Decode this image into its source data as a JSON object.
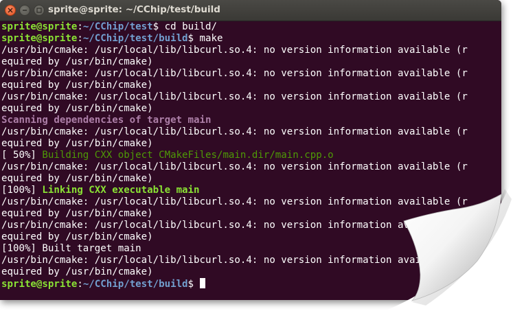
{
  "window": {
    "title": "sprite@sprite: ~/CChip/test/build"
  },
  "terminal": {
    "lines": [
      {
        "type": "prompt",
        "user": "sprite@sprite",
        "sep": ":",
        "path": "~/CChip/test",
        "end": "$ ",
        "cmd": "cd build/"
      },
      {
        "type": "prompt",
        "user": "sprite@sprite",
        "sep": ":",
        "path": "~/CChip/test/build",
        "end": "$ ",
        "cmd": "make"
      },
      {
        "type": "plain",
        "text": "/usr/bin/cmake: /usr/local/lib/libcurl.so.4: no version information available (r"
      },
      {
        "type": "plain",
        "text": "equired by /usr/bin/cmake)"
      },
      {
        "type": "plain",
        "text": "/usr/bin/cmake: /usr/local/lib/libcurl.so.4: no version information available (r"
      },
      {
        "type": "plain",
        "text": "equired by /usr/bin/cmake)"
      },
      {
        "type": "plain",
        "text": "/usr/bin/cmake: /usr/local/lib/libcurl.so.4: no version information available (r"
      },
      {
        "type": "plain",
        "text": "equired by /usr/bin/cmake)"
      },
      {
        "type": "magenta",
        "text": "Scanning dependencies of target main"
      },
      {
        "type": "plain",
        "text": "/usr/bin/cmake: /usr/local/lib/libcurl.so.4: no version information available (r"
      },
      {
        "type": "plain",
        "text": "equired by /usr/bin/cmake)"
      },
      {
        "type": "progress",
        "prefix": "[ 50%] ",
        "text": "Building CXX object CMakeFiles/main.dir/main.cpp.o",
        "style": "green"
      },
      {
        "type": "plain",
        "text": "/usr/bin/cmake: /usr/local/lib/libcurl.so.4: no version information available (r"
      },
      {
        "type": "plain",
        "text": "equired by /usr/bin/cmake)"
      },
      {
        "type": "progress",
        "prefix": "[100%] ",
        "text": "Linking CXX executable main",
        "style": "green-bold"
      },
      {
        "type": "plain",
        "text": "/usr/bin/cmake: /usr/local/lib/libcurl.so.4: no version information available (r"
      },
      {
        "type": "plain",
        "text": "equired by /usr/bin/cmake)"
      },
      {
        "type": "plain",
        "text": "/usr/bin/cmake: /usr/local/lib/libcurl.so.4: no version information available (r"
      },
      {
        "type": "plain",
        "text": "equired by /usr/bin/cmake)"
      },
      {
        "type": "plain",
        "text": "[100%] Built target main"
      },
      {
        "type": "plain",
        "text": "/usr/bin/cmake: /usr/local/lib/libcurl.so.4: no version information available (r"
      },
      {
        "type": "plain",
        "text": "equired by /usr/bin/cmake)"
      },
      {
        "type": "prompt",
        "user": "sprite@sprite",
        "sep": ":",
        "path": "~/CChip/test/build",
        "end": "$ ",
        "cmd": "",
        "cursor": true
      }
    ]
  },
  "colors": {
    "background": "#300a24",
    "user": "#8ae234",
    "path": "#729fcf",
    "magenta": "#ad7fa8",
    "green": "#4e9a06",
    "close_button": "#e25424"
  },
  "icons": {
    "close": "close-icon",
    "minimize": "minimize-icon",
    "maximize": "maximize-icon"
  }
}
